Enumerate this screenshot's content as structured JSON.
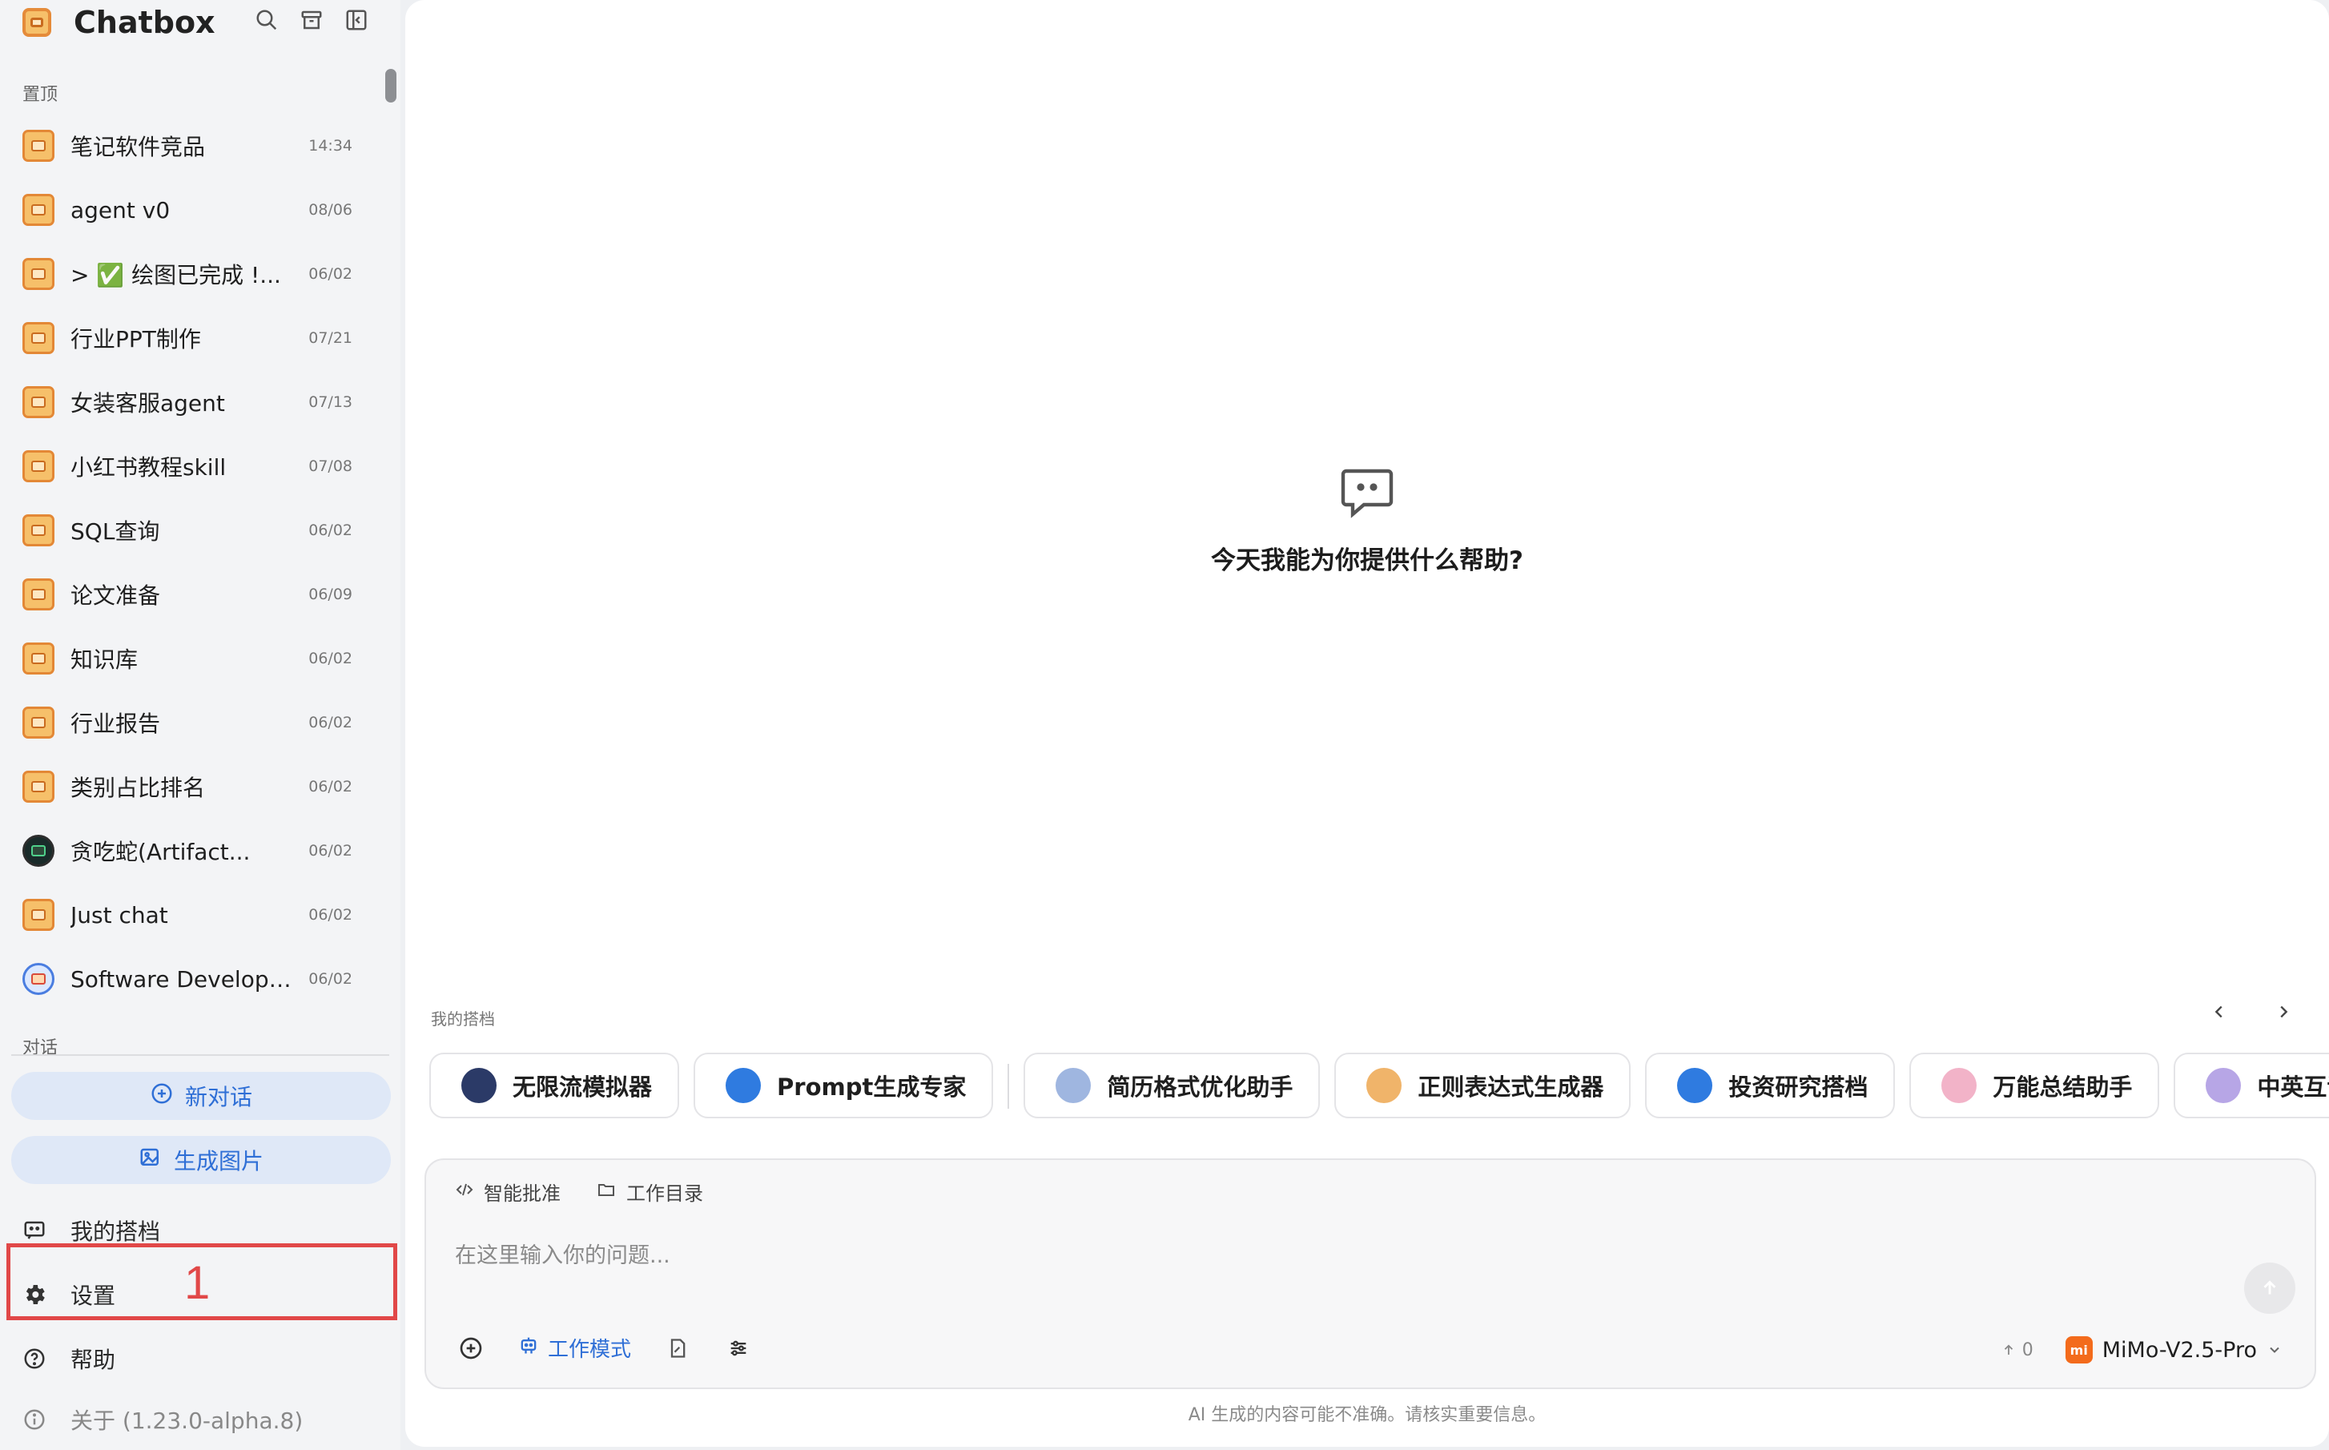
{
  "app": {
    "title": "Chatbox"
  },
  "sidebar": {
    "pinned_label": "置顶",
    "sessions": [
      {
        "title": "笔记软件竞品",
        "date": "14:34",
        "icon": "chatbox-icon"
      },
      {
        "title": "agent v0",
        "date": "08/06",
        "icon": "chatbox-icon"
      },
      {
        "title": "> ✅ 绘图已完成 !...",
        "date": "06/02",
        "icon": "chatbox-icon"
      },
      {
        "title": "行业PPT制作",
        "date": "07/21",
        "icon": "chatbox-icon"
      },
      {
        "title": "女装客服agent",
        "date": "07/13",
        "icon": "chatbox-icon"
      },
      {
        "title": "小红书教程skill",
        "date": "07/08",
        "icon": "chatbox-icon"
      },
      {
        "title": "SQL查询",
        "date": "06/02",
        "icon": "chatbox-icon"
      },
      {
        "title": "论文准备",
        "date": "06/09",
        "icon": "chatbox-icon"
      },
      {
        "title": "知识库",
        "date": "06/02",
        "icon": "chatbox-icon"
      },
      {
        "title": "行业报告",
        "date": "06/02",
        "icon": "chatbox-icon"
      },
      {
        "title": "类别占比排名",
        "date": "06/02",
        "icon": "chatbox-icon"
      },
      {
        "title": "贪吃蛇(Artifact...",
        "date": "06/02",
        "icon": "snake-avatar-icon"
      },
      {
        "title": "Just chat",
        "date": "06/02",
        "icon": "chatbox-icon"
      },
      {
        "title": "Software Developer...",
        "date": "06/02",
        "icon": "developer-avatar-icon"
      }
    ],
    "conversations_label": "对话",
    "new_chat": "新对话",
    "generate_image": "生成图片",
    "my_partners": "我的搭档",
    "settings": "设置",
    "help": "帮助",
    "about": "关于 (1.23.0-alpha.8)",
    "annotation_number": "1"
  },
  "main": {
    "empty_prompt": "今天我能为你提供什么帮助?",
    "partners_label": "我的搭档",
    "partners": [
      {
        "name": "无限流模拟器",
        "color": "#2b3a67"
      },
      {
        "name": "Prompt生成专家",
        "color": "#2f7be0"
      },
      {
        "name": "简历格式优化助手",
        "color": "#9fb6e0"
      },
      {
        "name": "正则表达式生成器",
        "color": "#f0b46a"
      },
      {
        "name": "投资研究搭档",
        "color": "#2f7be0"
      },
      {
        "name": "万能总结助手",
        "color": "#f2b3c8"
      },
      {
        "name": "中英互译专家",
        "color": "#b7a6e6"
      }
    ],
    "composer": {
      "tab_approve": "智能批准",
      "tab_workdir": "工作目录",
      "placeholder": "在这里输入你的问题...",
      "work_mode": "工作模式",
      "token_count": "0",
      "model": "MiMo-V2.5-Pro",
      "model_logo": "mi"
    },
    "disclaimer": "AI 生成的内容可能不准确。请核实重要信息。"
  },
  "colors": {
    "accent": "#2f6fd6",
    "annotation": "#e14848"
  }
}
